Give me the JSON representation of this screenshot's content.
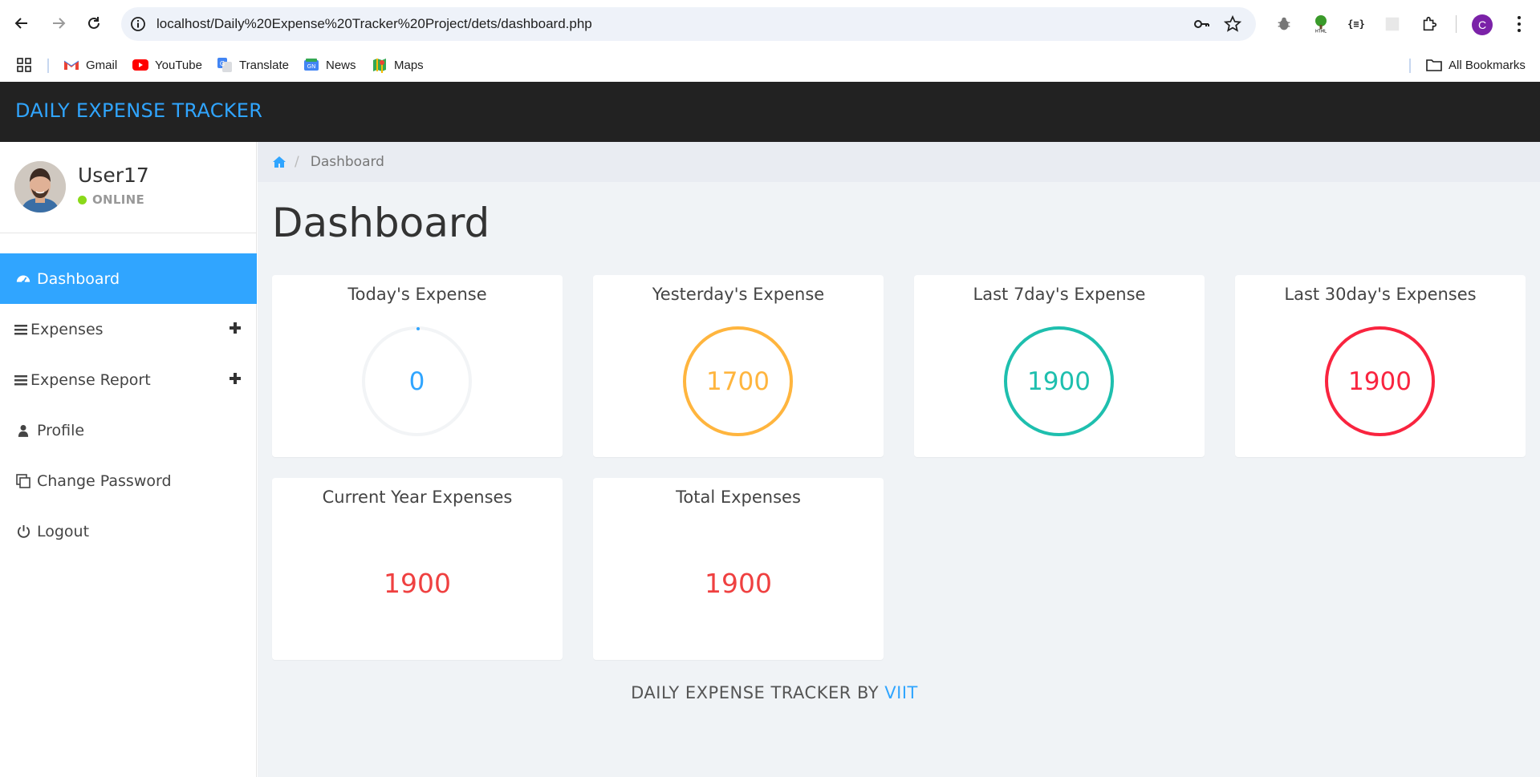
{
  "browser": {
    "url": "localhost/Daily%20Expense%20Tracker%20Project/dets/dashboard.php",
    "profile_initial": "C",
    "bookmarks": [
      {
        "label": "Gmail",
        "icon": "gmail-icon"
      },
      {
        "label": "YouTube",
        "icon": "youtube-icon"
      },
      {
        "label": "Translate",
        "icon": "translate-icon"
      },
      {
        "label": "News",
        "icon": "news-icon"
      },
      {
        "label": "Maps",
        "icon": "maps-icon"
      }
    ],
    "all_bookmarks_label": "All Bookmarks"
  },
  "app": {
    "brand": "DAILY EXPENSE TRACKER",
    "accent_color": "#30a5ff",
    "header_color": "#222222"
  },
  "sidebar": {
    "user_name": "User17",
    "status": "ONLINE",
    "items": [
      {
        "label": "Dashboard",
        "icon": "dashboard-icon",
        "active": true
      },
      {
        "label": "Expenses",
        "icon": "list-icon",
        "expandable": true
      },
      {
        "label": "Expense Report",
        "icon": "list-icon",
        "expandable": true
      },
      {
        "label": "Profile",
        "icon": "user-icon"
      },
      {
        "label": "Change Password",
        "icon": "clone-icon"
      },
      {
        "label": "Logout",
        "icon": "power-icon"
      }
    ]
  },
  "breadcrumb": {
    "current": "Dashboard"
  },
  "page": {
    "title": "Dashboard"
  },
  "cards": {
    "today": {
      "title": "Today's Expense",
      "value": "0",
      "color": "#30a5ff"
    },
    "yesterday": {
      "title": "Yesterday's Expense",
      "value": "1700",
      "color": "#ffb53e"
    },
    "last7": {
      "title": "Last 7day's Expense",
      "value": "1900",
      "color": "#1ebfae"
    },
    "last30": {
      "title": "Last 30day's Expenses",
      "value": "1900",
      "color": "#f9243f"
    },
    "year": {
      "title": "Current Year Expenses",
      "value": "1900",
      "color": "#ef4040"
    },
    "total": {
      "title": "Total Expenses",
      "value": "1900",
      "color": "#ef4040"
    }
  },
  "footer": {
    "text": "DAILY EXPENSE TRACKER BY",
    "link": "VIIT"
  }
}
